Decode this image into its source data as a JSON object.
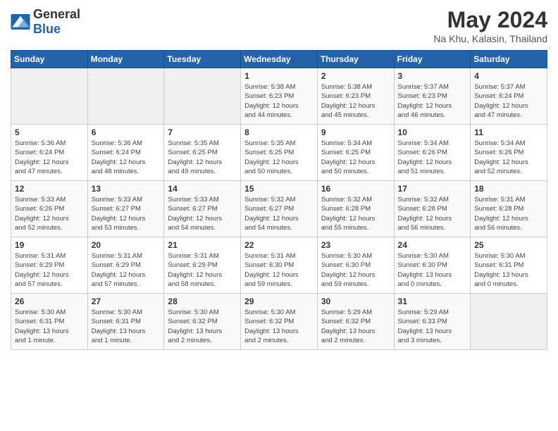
{
  "header": {
    "logo_general": "General",
    "logo_blue": "Blue",
    "title": "May 2024",
    "subtitle": "Na Khu, Kalasin, Thailand"
  },
  "calendar": {
    "days_of_week": [
      "Sunday",
      "Monday",
      "Tuesday",
      "Wednesday",
      "Thursday",
      "Friday",
      "Saturday"
    ],
    "weeks": [
      [
        {
          "day": "",
          "info": ""
        },
        {
          "day": "",
          "info": ""
        },
        {
          "day": "",
          "info": ""
        },
        {
          "day": "1",
          "info": "Sunrise: 5:38 AM\nSunset: 6:23 PM\nDaylight: 12 hours\nand 44 minutes."
        },
        {
          "day": "2",
          "info": "Sunrise: 5:38 AM\nSunset: 6:23 PM\nDaylight: 12 hours\nand 45 minutes."
        },
        {
          "day": "3",
          "info": "Sunrise: 5:37 AM\nSunset: 6:23 PM\nDaylight: 12 hours\nand 46 minutes."
        },
        {
          "day": "4",
          "info": "Sunrise: 5:37 AM\nSunset: 6:24 PM\nDaylight: 12 hours\nand 47 minutes."
        }
      ],
      [
        {
          "day": "5",
          "info": "Sunrise: 5:36 AM\nSunset: 6:24 PM\nDaylight: 12 hours\nand 47 minutes."
        },
        {
          "day": "6",
          "info": "Sunrise: 5:36 AM\nSunset: 6:24 PM\nDaylight: 12 hours\nand 48 minutes."
        },
        {
          "day": "7",
          "info": "Sunrise: 5:35 AM\nSunset: 6:25 PM\nDaylight: 12 hours\nand 49 minutes."
        },
        {
          "day": "8",
          "info": "Sunrise: 5:35 AM\nSunset: 6:25 PM\nDaylight: 12 hours\nand 50 minutes."
        },
        {
          "day": "9",
          "info": "Sunrise: 5:34 AM\nSunset: 6:25 PM\nDaylight: 12 hours\nand 50 minutes."
        },
        {
          "day": "10",
          "info": "Sunrise: 5:34 AM\nSunset: 6:26 PM\nDaylight: 12 hours\nand 51 minutes."
        },
        {
          "day": "11",
          "info": "Sunrise: 5:34 AM\nSunset: 6:26 PM\nDaylight: 12 hours\nand 52 minutes."
        }
      ],
      [
        {
          "day": "12",
          "info": "Sunrise: 5:33 AM\nSunset: 6:26 PM\nDaylight: 12 hours\nand 52 minutes."
        },
        {
          "day": "13",
          "info": "Sunrise: 5:33 AM\nSunset: 6:27 PM\nDaylight: 12 hours\nand 53 minutes."
        },
        {
          "day": "14",
          "info": "Sunrise: 5:33 AM\nSunset: 6:27 PM\nDaylight: 12 hours\nand 54 minutes."
        },
        {
          "day": "15",
          "info": "Sunrise: 5:32 AM\nSunset: 6:27 PM\nDaylight: 12 hours\nand 54 minutes."
        },
        {
          "day": "16",
          "info": "Sunrise: 5:32 AM\nSunset: 6:28 PM\nDaylight: 12 hours\nand 55 minutes."
        },
        {
          "day": "17",
          "info": "Sunrise: 5:32 AM\nSunset: 6:28 PM\nDaylight: 12 hours\nand 56 minutes."
        },
        {
          "day": "18",
          "info": "Sunrise: 5:31 AM\nSunset: 6:28 PM\nDaylight: 12 hours\nand 56 minutes."
        }
      ],
      [
        {
          "day": "19",
          "info": "Sunrise: 5:31 AM\nSunset: 6:29 PM\nDaylight: 12 hours\nand 57 minutes."
        },
        {
          "day": "20",
          "info": "Sunrise: 5:31 AM\nSunset: 6:29 PM\nDaylight: 12 hours\nand 57 minutes."
        },
        {
          "day": "21",
          "info": "Sunrise: 5:31 AM\nSunset: 6:29 PM\nDaylight: 12 hours\nand 58 minutes."
        },
        {
          "day": "22",
          "info": "Sunrise: 5:31 AM\nSunset: 6:30 PM\nDaylight: 12 hours\nand 59 minutes."
        },
        {
          "day": "23",
          "info": "Sunrise: 5:30 AM\nSunset: 6:30 PM\nDaylight: 12 hours\nand 59 minutes."
        },
        {
          "day": "24",
          "info": "Sunrise: 5:30 AM\nSunset: 6:30 PM\nDaylight: 13 hours\nand 0 minutes."
        },
        {
          "day": "25",
          "info": "Sunrise: 5:30 AM\nSunset: 6:31 PM\nDaylight: 13 hours\nand 0 minutes."
        }
      ],
      [
        {
          "day": "26",
          "info": "Sunrise: 5:30 AM\nSunset: 6:31 PM\nDaylight: 13 hours\nand 1 minute."
        },
        {
          "day": "27",
          "info": "Sunrise: 5:30 AM\nSunset: 6:31 PM\nDaylight: 13 hours\nand 1 minute."
        },
        {
          "day": "28",
          "info": "Sunrise: 5:30 AM\nSunset: 6:32 PM\nDaylight: 13 hours\nand 2 minutes."
        },
        {
          "day": "29",
          "info": "Sunrise: 5:30 AM\nSunset: 6:32 PM\nDaylight: 13 hours\nand 2 minutes."
        },
        {
          "day": "30",
          "info": "Sunrise: 5:29 AM\nSunset: 6:32 PM\nDaylight: 13 hours\nand 2 minutes."
        },
        {
          "day": "31",
          "info": "Sunrise: 5:29 AM\nSunset: 6:33 PM\nDaylight: 13 hours\nand 3 minutes."
        },
        {
          "day": "",
          "info": ""
        }
      ]
    ]
  }
}
